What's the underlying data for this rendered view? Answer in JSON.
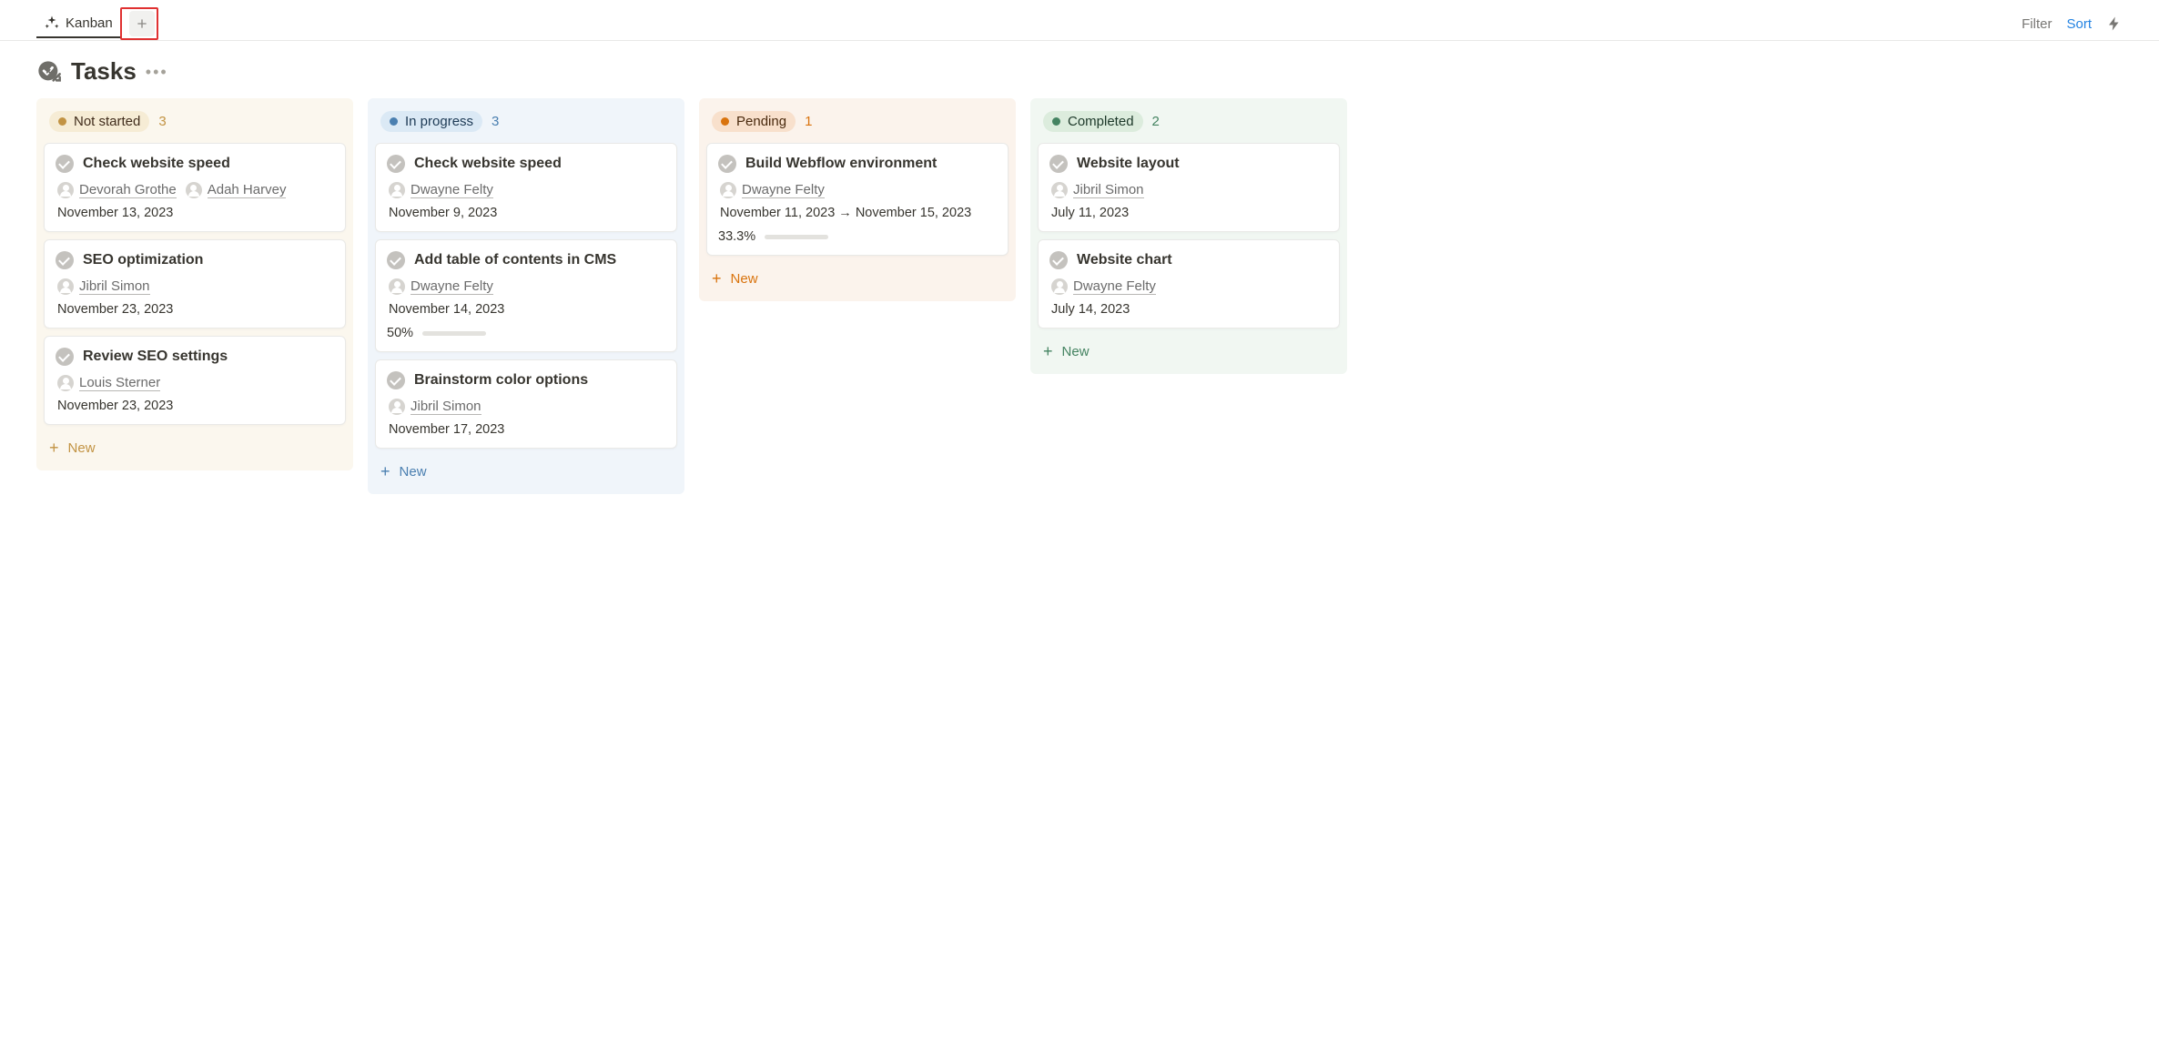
{
  "tabs": {
    "active": "Kanban"
  },
  "toolbar": {
    "filter": "Filter",
    "sort": "Sort"
  },
  "page": {
    "title": "Tasks"
  },
  "new_label": "New",
  "columns": [
    {
      "key": "notstarted",
      "label": "Not started",
      "count": "3",
      "cards": [
        {
          "title": "Check website speed",
          "assignees": [
            "Devorah Grothe",
            "Adah Harvey"
          ],
          "date": "November 13, 2023"
        },
        {
          "title": "SEO optimization",
          "assignees": [
            "Jibril Simon"
          ],
          "date": "November 23, 2023"
        },
        {
          "title": "Review SEO settings",
          "assignees": [
            "Louis Sterner"
          ],
          "date": "November 23, 2023"
        }
      ]
    },
    {
      "key": "inprogress",
      "label": "In progress",
      "count": "3",
      "cards": [
        {
          "title": "Check website speed",
          "assignees": [
            "Dwayne Felty"
          ],
          "date": "November 9, 2023"
        },
        {
          "title": "Add table of contents in CMS",
          "assignees": [
            "Dwayne Felty"
          ],
          "date": "November 14, 2023",
          "progress_label": "50%",
          "progress_pct": 50
        },
        {
          "title": "Brainstorm color options",
          "assignees": [
            "Jibril Simon"
          ],
          "date": "November 17, 2023"
        }
      ]
    },
    {
      "key": "pending",
      "label": "Pending",
      "count": "1",
      "cards": [
        {
          "title": "Build Webflow environment",
          "assignees": [
            "Dwayne Felty"
          ],
          "date": "November 11, 2023 → November 15, 2023",
          "progress_label": "33.3%",
          "progress_pct": 33.3
        }
      ]
    },
    {
      "key": "completed",
      "label": "Completed",
      "count": "2",
      "cards": [
        {
          "title": "Website layout",
          "assignees": [
            "Jibril Simon"
          ],
          "date": "July 11, 2023"
        },
        {
          "title": "Website chart",
          "assignees": [
            "Dwayne Felty"
          ],
          "date": "July 14, 2023"
        }
      ]
    }
  ]
}
